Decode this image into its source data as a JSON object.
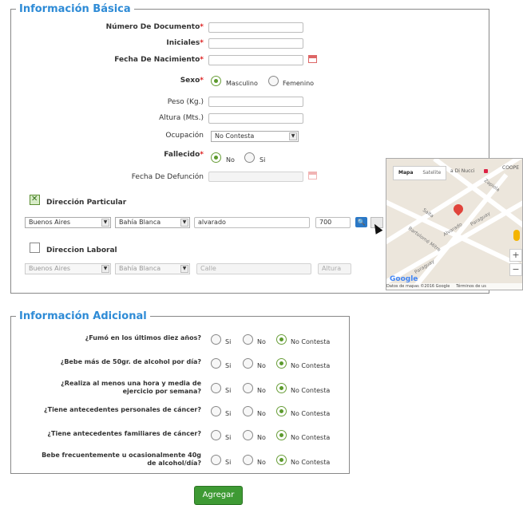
{
  "basic": {
    "legend": "Información Básica",
    "fields": {
      "documento": {
        "label": "Número De Documento",
        "req": "*"
      },
      "iniciales": {
        "label": "Iniciales",
        "req": "*"
      },
      "nacimiento": {
        "label": "Fecha De Nacimiento",
        "req": "*"
      },
      "sexo": {
        "label": "Sexo",
        "req": "*",
        "opt1": "Masculino",
        "opt2": "Femenino"
      },
      "peso": {
        "label": "Peso (Kg.)"
      },
      "altura": {
        "label": "Altura (Mts.)"
      },
      "ocupacion": {
        "label": "Ocupación",
        "value": "No Contesta"
      },
      "fallecido": {
        "label": "Fallecido",
        "req": "*",
        "opt1": "No",
        "opt2": "Si"
      },
      "defuncion": {
        "label": "Fecha De Defunción"
      }
    },
    "dir_particular": {
      "label": "Dirección Particular",
      "provincia": "Buenos Aires",
      "localidad": "Bahía Blanca",
      "calle": "alvarado",
      "altura": "700"
    },
    "dir_laboral": {
      "label": "Direccion Laboral",
      "provincia": "Buenos Aires",
      "localidad": "Bahía Blanca",
      "calle_placeholder": "Calle",
      "altura_placeholder": "Altura"
    }
  },
  "map": {
    "btn_mapa": "Mapa",
    "btn_satelite": "Satelite",
    "poi": "a Di Nucci",
    "poi2": "COOPE",
    "streets": [
      "Zapiola",
      "Salta",
      "Alvarado",
      "Paraguay",
      "Bartolomé Mitre",
      "Paraguay"
    ],
    "footer": "Datos de mapas ©2016 Google",
    "terms": "Términos de us",
    "google": "Google"
  },
  "additional": {
    "legend": "Información Adicional",
    "options": [
      "Si",
      "No",
      "No Contesta"
    ],
    "questions": [
      {
        "q1": "¿Fumó en los últimos diez años?",
        "q2": ""
      },
      {
        "q1": "¿Bebe más de 50gr. de alcohol por día?",
        "q2": ""
      },
      {
        "q1": "¿Realiza al menos una hora y media de",
        "q2": "ejercicio por semana?"
      },
      {
        "q1": "¿Tiene antecedentes personales de cáncer?",
        "q2": ""
      },
      {
        "q1": "¿Tiene antecedentes familiares de cáncer?",
        "q2": ""
      },
      {
        "q1": "Bebe frecuentemente u ocasionalmente 40g",
        "q2": "de alcohol/día?"
      }
    ]
  },
  "submit": "Agregar"
}
